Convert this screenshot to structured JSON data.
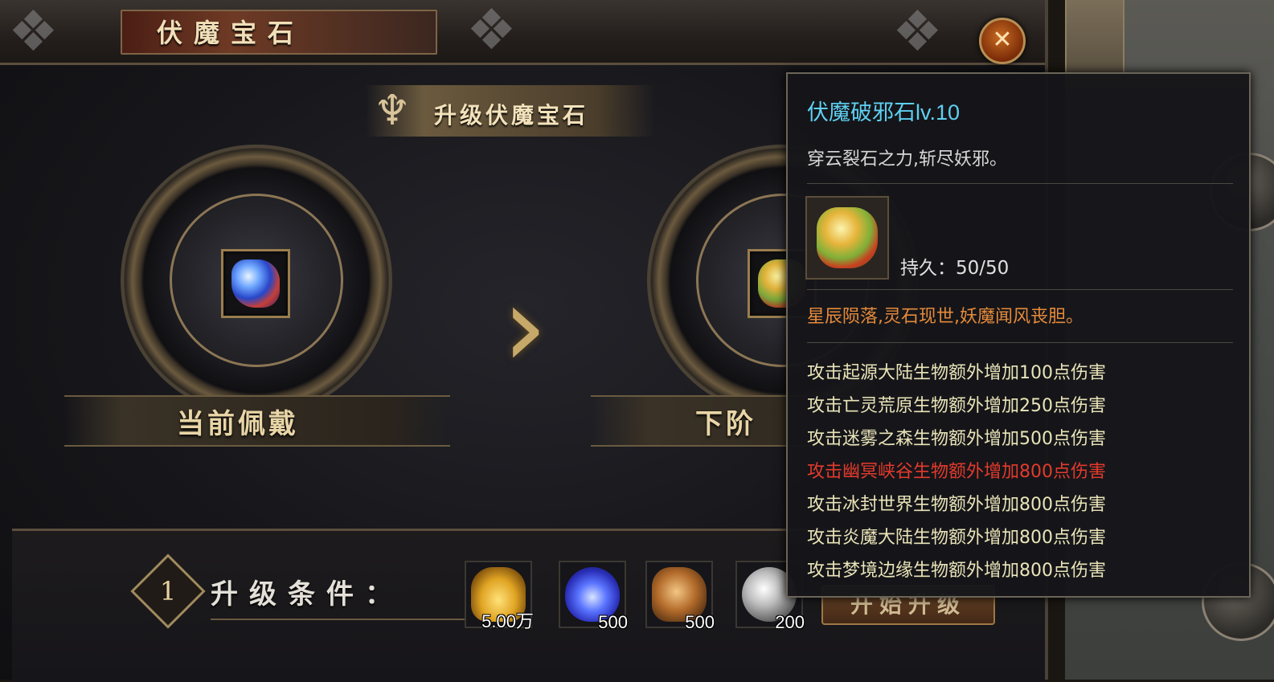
{
  "panel": {
    "title": "伏魔宝石",
    "close_icon": "close-icon"
  },
  "upgrade": {
    "header": "升级伏魔宝石",
    "current_label": "当前佩戴",
    "next_label": "下阶"
  },
  "conditions": {
    "step": "1",
    "label": "升级条件：",
    "items": [
      {
        "name": "gold-ingot-icon",
        "count": "5.00万"
      },
      {
        "name": "blue-flame-icon",
        "count": "500"
      },
      {
        "name": "ore-chunk-icon",
        "count": "500"
      },
      {
        "name": "silver-orb-icon",
        "count": "200"
      }
    ],
    "start_button": "开始升级"
  },
  "tooltip": {
    "title": "伏魔破邪石lv.10",
    "description": "穿云裂石之力,斩尽妖邪。",
    "durability": "持久：50/50",
    "lore": "星辰陨落,灵石现世,妖魔闻风丧胆。",
    "effects": [
      {
        "text": "攻击起源大陆生物额外增加100点伤害",
        "highlight": false
      },
      {
        "text": "攻击亡灵荒原生物额外增加250点伤害",
        "highlight": false
      },
      {
        "text": "攻击迷雾之森生物额外增加500点伤害",
        "highlight": false
      },
      {
        "text": "攻击幽冥峡谷生物额外增加800点伤害",
        "highlight": true
      },
      {
        "text": "攻击冰封世界生物额外增加800点伤害",
        "highlight": false
      },
      {
        "text": "攻击炎魔大陆生物额外增加800点伤害",
        "highlight": false
      },
      {
        "text": "攻击梦境边缘生物额外增加800点伤害",
        "highlight": false
      }
    ]
  },
  "colors": {
    "title_cyan": "#5fd0f2",
    "lore_orange": "#e58a3a",
    "effect_normal": "#e9e4b8",
    "effect_highlight": "#e33a2c",
    "gold_accent": "#b88f55"
  }
}
